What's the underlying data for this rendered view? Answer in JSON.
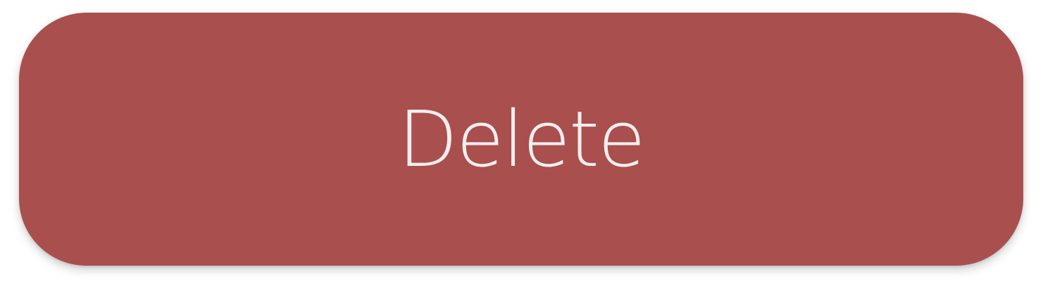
{
  "button": {
    "label": "Delete",
    "background_color": "#a94f4e",
    "text_color": "#f6eeee"
  }
}
